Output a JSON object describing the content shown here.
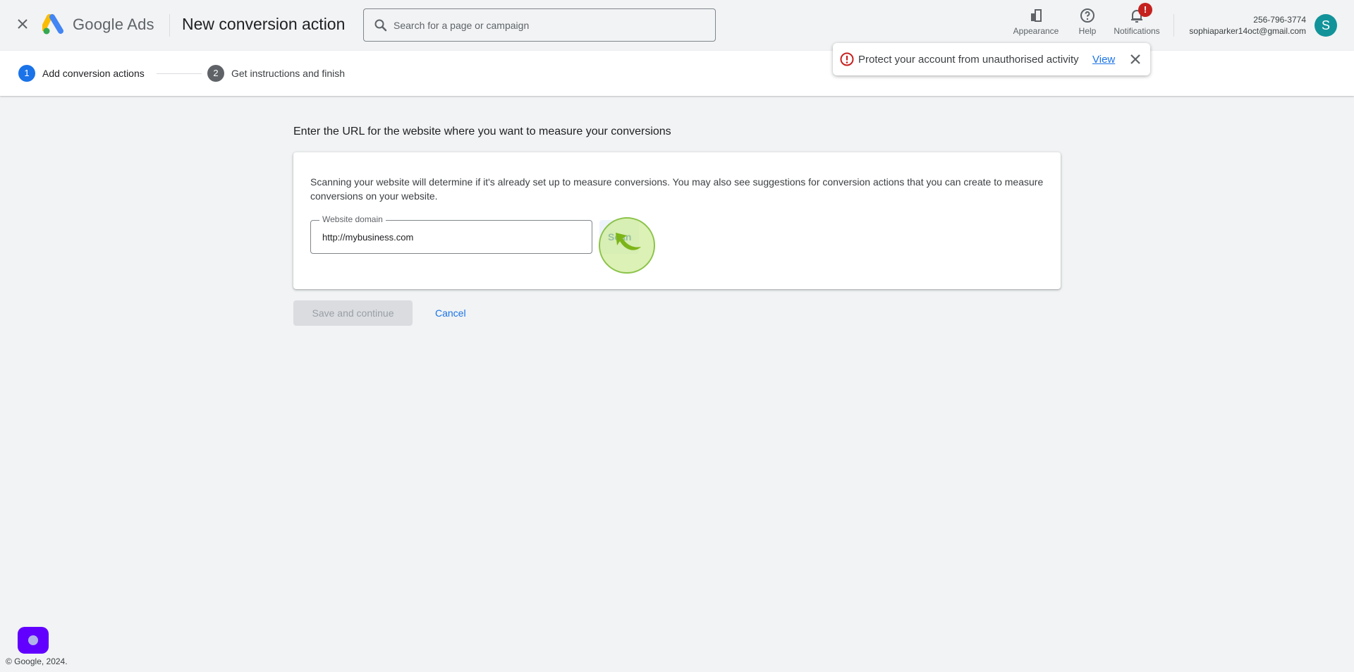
{
  "header": {
    "close_icon": "close-icon",
    "brand": "Google Ads",
    "page_title": "New conversion action",
    "search": {
      "placeholder": "Search for a page or campaign",
      "value": ""
    },
    "buttons": [
      {
        "label": "Appearance",
        "icon": "appearance-icon"
      },
      {
        "label": "Help",
        "icon": "help-icon"
      },
      {
        "label": "Notifications",
        "icon": "bell-icon",
        "badge": "!"
      }
    ],
    "account": {
      "phone": "256-796-3774",
      "email": "sophiaparker14oct@gmail.com",
      "avatar_initial": "S",
      "avatar_color": "#12939a"
    }
  },
  "stepper": {
    "steps": [
      {
        "number": "1",
        "label": "Add conversion actions",
        "active": true
      },
      {
        "number": "2",
        "label": "Get instructions and finish",
        "active": false
      }
    ]
  },
  "toast": {
    "message": "Protect your account from unauthorised activity",
    "link": "View"
  },
  "main": {
    "heading": "Enter the URL for the website where you want to measure your conversions",
    "description": "Scanning your website will determine if it's already set up to measure conversions. You may also see suggestions for conversion actions that you can create to measure conversions on your website.",
    "domain_field": {
      "label": "Website domain",
      "value": "http://mybusiness.com"
    },
    "scan_button": "Scan",
    "save_button": "Save and continue",
    "cancel_link": "Cancel"
  },
  "footer": {
    "copyright": "© Google, 2024."
  },
  "colors": {
    "accent": "#1a73e8",
    "alert": "#c5221f",
    "assistant": "#6200ff"
  }
}
